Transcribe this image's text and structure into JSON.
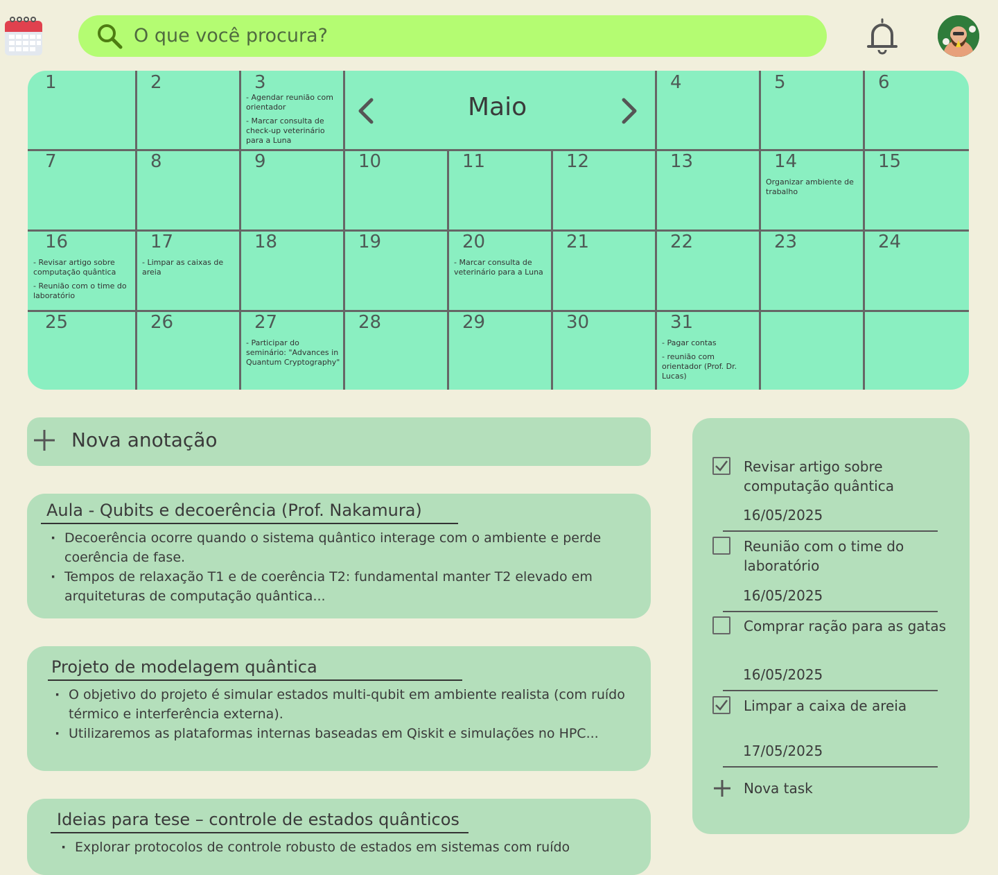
{
  "search": {
    "placeholder": "O que você procura?"
  },
  "icons": {
    "app": "calendar-icon",
    "search": "search-icon",
    "notifications": "bell-icon",
    "user": "avatar"
  },
  "calendar": {
    "month": "Maio",
    "days": [
      {
        "day": "1",
        "notes": []
      },
      {
        "day": "2",
        "notes": []
      },
      {
        "day": "3",
        "notes": [
          "- Agendar reunião com orientador",
          "- Marcar consulta de check-up veterinário para a Luna"
        ]
      },
      {
        "day": "4",
        "notes": []
      },
      {
        "day": "5",
        "notes": []
      },
      {
        "day": "6",
        "notes": []
      },
      {
        "day": "7",
        "notes": []
      },
      {
        "day": "8",
        "notes": []
      },
      {
        "day": "9",
        "notes": []
      },
      {
        "day": "10",
        "notes": []
      },
      {
        "day": "11",
        "notes": []
      },
      {
        "day": "12",
        "notes": []
      },
      {
        "day": "13",
        "notes": []
      },
      {
        "day": "14",
        "notes": [
          "Organizar ambiente de trabalho"
        ]
      },
      {
        "day": "15",
        "notes": []
      },
      {
        "day": "16",
        "notes": [
          "- Revisar artigo sobre computação quântica",
          "- Reunião com o time do laboratório"
        ]
      },
      {
        "day": "17",
        "notes": [
          "- Limpar as caixas de areia"
        ]
      },
      {
        "day": "18",
        "notes": []
      },
      {
        "day": "19",
        "notes": []
      },
      {
        "day": "20",
        "notes": [
          "- Marcar consulta de veterinário para a Luna"
        ]
      },
      {
        "day": "21",
        "notes": []
      },
      {
        "day": "22",
        "notes": []
      },
      {
        "day": "23",
        "notes": []
      },
      {
        "day": "24",
        "notes": []
      },
      {
        "day": "25",
        "notes": []
      },
      {
        "day": "26",
        "notes": []
      },
      {
        "day": "27",
        "notes": [
          "- Participar do seminário: \"Advances in Quantum Cryptography\""
        ]
      },
      {
        "day": "28",
        "notes": []
      },
      {
        "day": "29",
        "notes": []
      },
      {
        "day": "30",
        "notes": []
      },
      {
        "day": "31",
        "notes": [
          "- Pagar contas",
          "- reunião com orientador (Prof. Dr. Lucas)"
        ]
      }
    ]
  },
  "new_note": {
    "label": "Nova anotação"
  },
  "notes": [
    {
      "title": "Aula - Qubits e decoerência (Prof. Nakamura)",
      "bullets": [
        "Decoerência ocorre quando o sistema quântico interage com o ambiente e perde coerência de fase.",
        "Tempos de relaxação T1 e de coerência T2: fundamental manter T2 elevado em arquiteturas de computação quântica..."
      ]
    },
    {
      "title": "Projeto de modelagem quântica",
      "bullets": [
        "O objetivo do projeto é simular estados multi-qubit em ambiente realista (com ruído térmico e interferência externa).",
        "Utilizaremos as plataformas internas baseadas em Qiskit e simulações no HPC..."
      ]
    },
    {
      "title": "Ideias para tese – controle de estados quânticos",
      "bullets": [
        "Explorar protocolos de controle robusto de estados em sistemas com ruído"
      ]
    }
  ],
  "tasks": {
    "items": [
      {
        "label": "Revisar artigo sobre computação quântica",
        "date": "16/05/2025",
        "done": true
      },
      {
        "label": "Reunião com o time do laboratório",
        "date": "16/05/2025",
        "done": false
      },
      {
        "label": "Comprar ração para as gatas",
        "date": "16/05/2025",
        "done": false
      },
      {
        "label": "Limpar a caixa de areia",
        "date": "17/05/2025",
        "done": true
      }
    ],
    "new_task_label": "Nova task"
  }
}
